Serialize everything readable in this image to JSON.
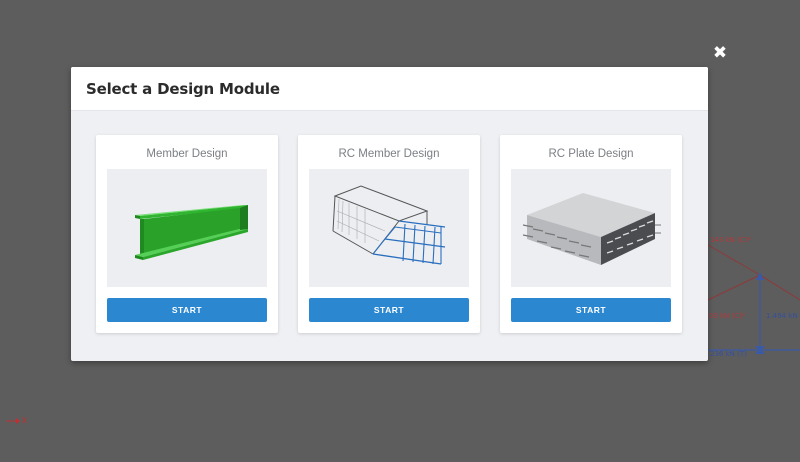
{
  "modal": {
    "title": "Select a Design Module",
    "close_icon": "close-icon"
  },
  "modules": [
    {
      "title": "Member Design",
      "button_label": "START",
      "image": "steel-i-beam"
    },
    {
      "title": "RC Member Design",
      "button_label": "START",
      "image": "rc-beam-wireframe"
    },
    {
      "title": "RC Plate Design",
      "button_label": "START",
      "image": "rc-plate"
    }
  ],
  "background": {
    "labels": [
      "143 kN (C)*",
      "03 kN (C)*",
      "1.494 kN",
      "236 kN (T)"
    ],
    "axis_label": "x"
  },
  "colors": {
    "backdrop": "#5c5d5c",
    "button": "#2a87d0",
    "beam": "#2fa02f"
  }
}
